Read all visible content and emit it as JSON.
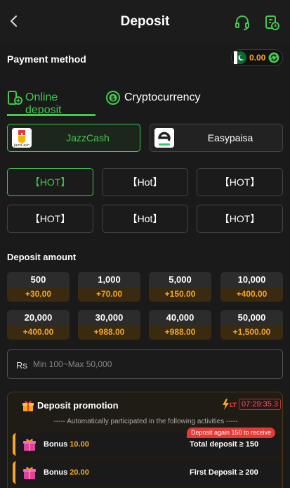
{
  "header": {
    "title": "Deposit",
    "back_icon": "back-arrow-icon",
    "support_icon": "headset-icon",
    "history_icon": "history-icon"
  },
  "payment": {
    "title": "Payment method",
    "balance": "0.00"
  },
  "tabs": [
    {
      "label": "Online deposit",
      "active": true
    },
    {
      "label": "Cryptocurrency",
      "active": false
    }
  ],
  "methods": [
    {
      "name": "JazzCash",
      "logo_text": "JazzCash",
      "active": true
    },
    {
      "name": "Easypaisa",
      "active": false
    }
  ],
  "channels": [
    "【HOT】",
    "【Hot】",
    "【HOT】",
    "【HOT】",
    "【Hot】",
    "【HOT】"
  ],
  "deposit": {
    "title": "Deposit amount",
    "amounts": [
      {
        "value": "500",
        "bonus": "+30.00"
      },
      {
        "value": "1,000",
        "bonus": "+70.00"
      },
      {
        "value": "5,000",
        "bonus": "+150.00"
      },
      {
        "value": "10,000",
        "bonus": "+400.00"
      },
      {
        "value": "20,000",
        "bonus": "+400.00"
      },
      {
        "value": "30,000",
        "bonus": "+988.00"
      },
      {
        "value": "40,000",
        "bonus": "+988.00"
      },
      {
        "value": "50,000",
        "bonus": "+1,500.00"
      }
    ],
    "currency": "Rs",
    "placeholder": "Min 100~Max 50,000"
  },
  "promotion": {
    "title": "Deposit promotion",
    "lt": "LT",
    "timer": "07:29:35.3",
    "subtitle": "----- Automatically participated in the following activities -----",
    "items": [
      {
        "label": "Bonus",
        "value": "10.00",
        "condition": "Total deposit ≥ 150",
        "tag": "Deposit again 150 to receive"
      },
      {
        "label": "Bonus",
        "value": "20.00",
        "condition": "First Deposit ≥ 200"
      }
    ]
  },
  "colors": {
    "accent": "#43c94f",
    "gold": "#f5a623",
    "danger": "#e53935"
  }
}
